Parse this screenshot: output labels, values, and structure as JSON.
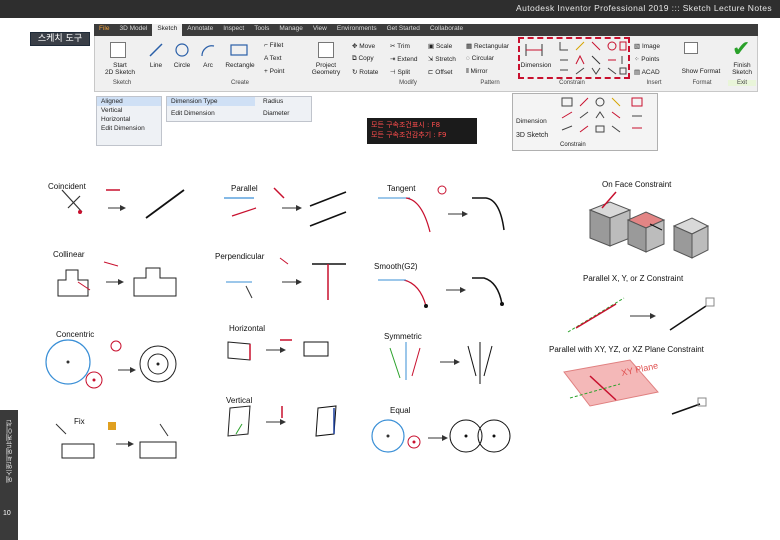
{
  "header": {
    "title": "Autodesk Inventor Professional 2019 ::: Sketch Lecture Notes"
  },
  "section": {
    "label": "스케치 도구"
  },
  "ribbon": {
    "tabs": [
      "File",
      "3D Model",
      "Sketch",
      "Annotate",
      "Inspect",
      "Tools",
      "Manage",
      "View",
      "Environments",
      "Get Started",
      "Collaborate"
    ],
    "active_tab": "Sketch",
    "items": {
      "start_2d": "Start\n2D Sketch",
      "line": "Line",
      "circle": "Circle",
      "arc": "Arc",
      "rectangle": "Rectangle",
      "fillet": "Fillet",
      "text": "Text",
      "point": "Point",
      "project_geometry": "Project\nGeometry",
      "move": "Move",
      "copy": "Copy",
      "rotate": "Rotate",
      "trim": "Trim",
      "extend": "Extend",
      "split": "Split",
      "scale": "Scale",
      "stretch": "Stretch",
      "offset": "Offset",
      "rect_pattern": "Rectangular",
      "circular_pattern": "Circular",
      "mirror": "Mirror",
      "dimension": "Dimension",
      "image": "Image",
      "points": "Points",
      "acad": "ACAD",
      "show_format": "Show Format",
      "finish": "Finish\nSketch"
    },
    "groups": {
      "sketch": "Sketch",
      "create": "Create",
      "modify": "Modify",
      "pattern": "Pattern",
      "constrain": "Constrain",
      "insert": "Insert",
      "format": "Format",
      "exit": "Exit"
    }
  },
  "dropdown_left": {
    "rows": [
      "Aligned",
      "Vertical",
      "Horizontal",
      "Edit Dimension"
    ],
    "selected": "Aligned"
  },
  "dropdown_right": {
    "left_rows": [
      "Dimension Type",
      "Edit Dimension"
    ],
    "right_rows": [
      "Radius",
      "Diameter"
    ]
  },
  "hint": {
    "line1": "모든 구속조건표시 : F8",
    "line2": "모든 구속조건감추기 : F9"
  },
  "panel3d": {
    "dimension": "Dimension",
    "label": "3D Sketch",
    "group": "Constrain"
  },
  "constraints": {
    "coincident": "Coincident",
    "collinear": "Collinear",
    "concentric": "Concentric",
    "fix": "Fix",
    "parallel": "Parallel",
    "perpendicular": "Perpendicular",
    "horizontal": "Horizontal",
    "vertical": "Vertical",
    "tangent": "Tangent",
    "smooth": "Smooth(G2)",
    "symmetric": "Symmetric",
    "equal": "Equal",
    "on_face": "On Face Constraint",
    "parallel_xyz": "Parallel X, Y, or Z Constraint",
    "parallel_planes": "Parallel with XY, YZ, or XZ Plane Constraint",
    "xy_plane": "XY Plane"
  },
  "side": {
    "text": "에스앤씨에듀케이션",
    "page": "10"
  },
  "colors": {
    "accent_red": "#c8102e",
    "finish_green": "#2aa12a",
    "hint_red": "#ff4d4d",
    "blue_line": "#3a8fd6"
  }
}
